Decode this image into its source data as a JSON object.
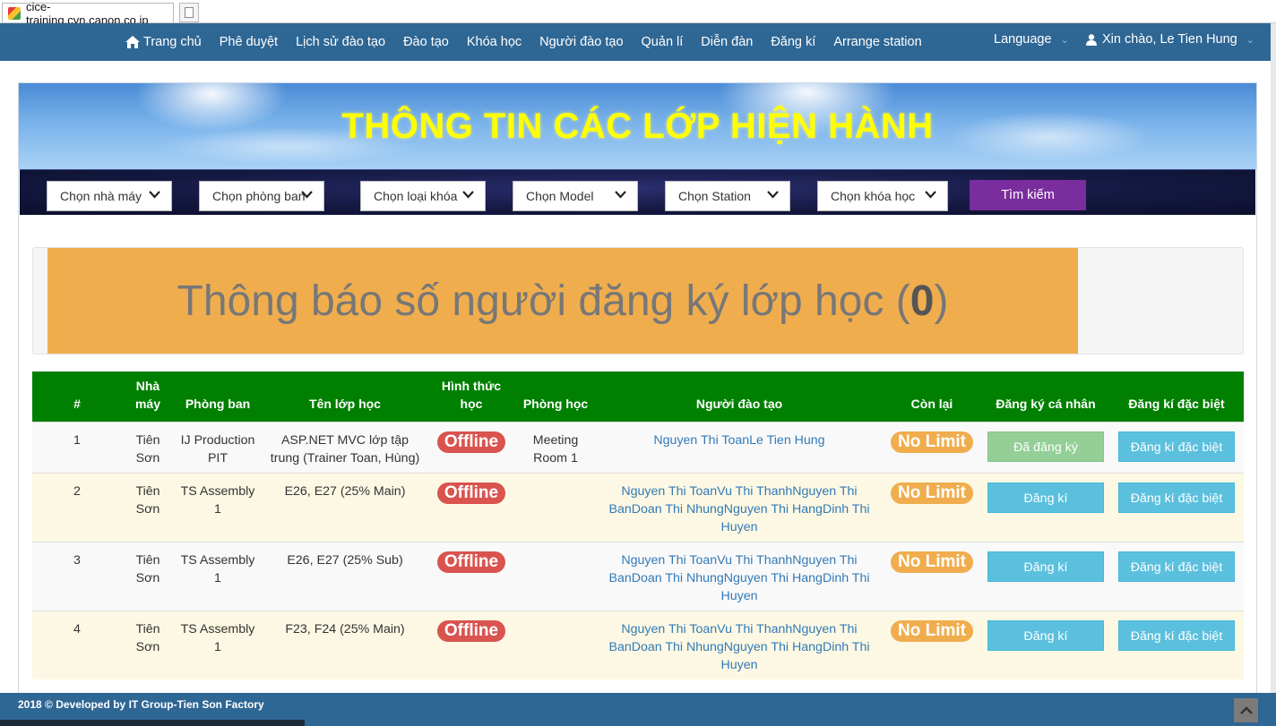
{
  "browser": {
    "tab_title": "cice-training.cvn.canon.co.jp"
  },
  "nav": {
    "items": [
      {
        "label": "Trang chủ",
        "icon": "home-icon"
      },
      {
        "label": "Phê duyệt"
      },
      {
        "label": "Lịch sử đào tạo"
      },
      {
        "label": "Đào tạo"
      },
      {
        "label": "Khóa học"
      },
      {
        "label": "Người đào tạo"
      },
      {
        "label": "Quản lí"
      },
      {
        "label": "Diễn đàn"
      },
      {
        "label": "Đăng kí"
      },
      {
        "label": "Arrange station"
      }
    ],
    "language": "Language",
    "greeting": "Xin chào, Le Tien Hung"
  },
  "banner": {
    "title": "THÔNG TIN CÁC LỚP HIỆN HÀNH"
  },
  "filters": {
    "factory": "Chọn nhà máy",
    "department": "Chọn phòng ban",
    "course_type": "Chọn loại khóa",
    "model": "Chọn Model",
    "station": "Chọn Station",
    "course": "Chọn khóa học",
    "search_label": "Tìm kiếm"
  },
  "notice": {
    "text": "Thông báo số người đăng ký lớp học (",
    "count": "0",
    "close": ")"
  },
  "table": {
    "headers": {
      "num": "#",
      "factory": "Nhà máy",
      "department": "Phòng ban",
      "class_name": "Tên lớp học",
      "format": "Hình thức học",
      "room": "Phòng học",
      "trainer": "Người đào tạo",
      "remaining": "Còn lại",
      "personal": "Đăng ký cá nhân",
      "special": "Đăng kí đặc biệt"
    },
    "rows": [
      {
        "num": "1",
        "factory": "Tiên Sơn",
        "department": "IJ Production PIT",
        "class_name": "ASP.NET MVC lớp tập trung (Trainer Toan, Hùng)",
        "format": "Offline",
        "room": "Meeting Room 1",
        "trainer": "Nguyen Thi ToanLe Tien Hung",
        "remaining": "No Limit",
        "personal": "Đã đăng ký",
        "special": "Đăng kí đặc biệt"
      },
      {
        "num": "2",
        "factory": "Tiên Sơn",
        "department": "TS Assembly 1",
        "class_name": "E26, E27 (25% Main)",
        "format": "Offline",
        "room": "",
        "trainer": "Nguyen Thi ToanVu Thi ThanhNguyen Thi BanDoan Thi NhungNguyen Thi HangDinh Thi Huyen",
        "remaining": "No Limit",
        "personal": "Đăng kí",
        "special": "Đăng kí đặc biệt"
      },
      {
        "num": "3",
        "factory": "Tiên Sơn",
        "department": "TS Assembly 1",
        "class_name": "E26, E27 (25% Sub)",
        "format": "Offline",
        "room": "",
        "trainer": "Nguyen Thi ToanVu Thi ThanhNguyen Thi BanDoan Thi NhungNguyen Thi HangDinh Thi Huyen",
        "remaining": "No Limit",
        "personal": "Đăng kí",
        "special": "Đăng kí đặc biệt"
      },
      {
        "num": "4",
        "factory": "Tiên Sơn",
        "department": "TS Assembly 1",
        "class_name": "F23, F24 (25% Main)",
        "format": "Offline",
        "room": "",
        "trainer": "Nguyen Thi ToanVu Thi ThanhNguyen Thi BanDoan Thi NhungNguyen Thi HangDinh Thi Huyen",
        "remaining": "No Limit",
        "personal": "Đăng kí",
        "special": "Đăng kí đặc biệt"
      }
    ]
  },
  "footer": {
    "text": "2018 © Developed by IT Group-Tien Son Factory"
  },
  "colors": {
    "navbar": "#2e6694",
    "banner_title": "#ffff00",
    "search_button": "#7a2d9c",
    "notice": "#f0ad4e",
    "table_header": "#008000",
    "offline_badge": "#d9534f",
    "nolimit_badge": "#f0ad4e",
    "register_button": "#5bc0de",
    "registered_button": "#93cf96"
  }
}
